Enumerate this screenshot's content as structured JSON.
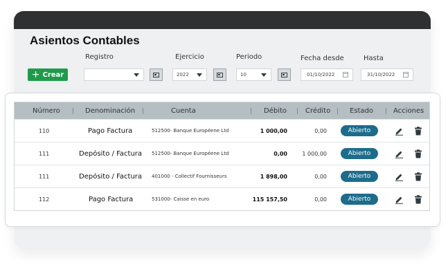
{
  "page": {
    "title": "Asientos Contables"
  },
  "filters": {
    "registro_label": "Registro",
    "registro_value": "",
    "ejercicio_label": "Ejercicio",
    "ejercicio_value": "2022",
    "periodo_label": "Periodo",
    "periodo_value": "10",
    "fecha_desde_label": "Fecha desde",
    "fecha_desde_value": "01/10/2022",
    "hasta_label": "Hasta",
    "hasta_value": "31/10/2022"
  },
  "toolbar": {
    "create_label": "Crear",
    "create_icon": "plus-icon"
  },
  "table": {
    "headers": {
      "numero": "Número",
      "denominacion": "Denominación",
      "cuenta": "Cuenta",
      "debito": "Débito",
      "credito": "Crédito",
      "estado": "Estado",
      "acciones": "Acciones"
    },
    "rows": [
      {
        "numero": "110",
        "denominacion": "Pago Factura",
        "cuenta": "512500- Banque Européene Ltd",
        "debito": "1 000,00",
        "credito": "0,00",
        "estado": "Abierto"
      },
      {
        "numero": "111",
        "denominacion": "Depósito / Factura",
        "cuenta": "512500- Banque Européene Ltd",
        "debito": "0,00",
        "credito": "1 000,00",
        "estado": "Abierto"
      },
      {
        "numero": "111",
        "denominacion": "Depósito / Factura",
        "cuenta": "401000 - Collectif Fournisseurs",
        "debito": "1 898,00",
        "credito": "0,00",
        "estado": "Abierto"
      },
      {
        "numero": "112",
        "denominacion": "Pago Factura",
        "cuenta": "531000- Caisse en euro",
        "debito": "115 157,50",
        "credito": "0,00",
        "estado": "Abierto"
      }
    ],
    "action_icons": [
      "pencil-icon",
      "trash-icon"
    ]
  },
  "colors": {
    "topbar": "#2f3032",
    "create_button": "#1f9a4b",
    "badge": "#1d6c8b",
    "table_header": "#b4bec3"
  }
}
